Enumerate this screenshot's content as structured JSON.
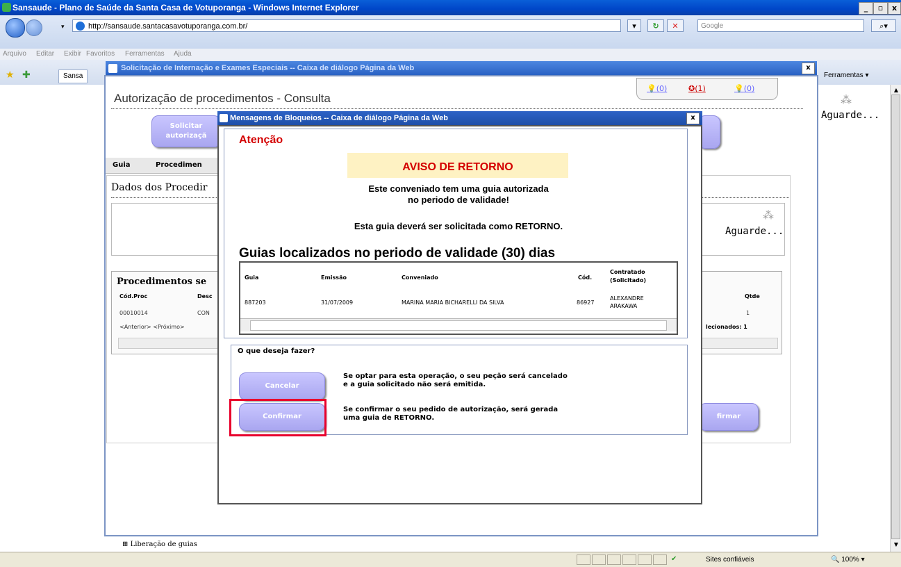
{
  "browser": {
    "title": "Sansaude - Plano de Saúde da Santa Casa de Votuporanga - Windows Internet Explorer",
    "url": "http://sansaude.santacasavotuporanga.com.br/",
    "search_placeholder": "Google",
    "menu": [
      "Arquivo",
      "Editar",
      "Exibir",
      "Favoritos",
      "Ferramentas",
      "Ajuda"
    ],
    "tab_label": "Sansa",
    "tools_label": "Ferramentas",
    "min_label": "_",
    "max_label": "▫",
    "close_label": "x",
    "status_zone": "Sites confiáveis",
    "zoom": "100%"
  },
  "outer_dialog": {
    "title": "Solicitação de Internação e Exames Especiais -- Caixa de diálogo Página da Web",
    "close_label": "x",
    "page_title": "Autorização de procedimentos - Consulta",
    "icon_counts": [
      "(0)",
      "(1)",
      "(0)"
    ],
    "solicitar_label": "Solicitar autorizaçã",
    "tabs": [
      "Guia",
      "Procedimen"
    ],
    "dados_title": "Dados dos Procedir",
    "aguarde_label": "Aguarde...",
    "proc_title": "Procedimentos se",
    "proc_headers": {
      "cod": "Cód.Proc",
      "desc": "Desc",
      "qtde": "Qtde"
    },
    "proc_row": {
      "cod": "00010014",
      "desc": "CON",
      "qtde": "1"
    },
    "paging": "<Anterior> <Próximo>",
    "selecionados": "lecionados: 1",
    "confirmar_bg_label": "firmar",
    "tree_label": "Liberação de guias",
    "aguarde_right": "Aguarde..."
  },
  "inner_dialog": {
    "title": "Mensagens de Bloqueios -- Caixa de diálogo Página da Web",
    "close_label": "x",
    "atencao": "Atenção",
    "aviso": "AVISO DE RETORNO",
    "msg_line1": "Este conveniado tem uma guia autorizada",
    "msg_line2": "no periodo de validade!",
    "msg_line3": "Esta guia deverá ser solicitada como RETORNO.",
    "guias_title": "Guias localizados no periodo de validade (30) dias",
    "table": {
      "headers": [
        "Guia",
        "Emissão",
        "Conveniado",
        "Cód.",
        "Contratado",
        "(Solicitado)"
      ],
      "row": {
        "guia": "887203",
        "emissao": "31/07/2009",
        "conveniado": "MARINA MARIA BICHARELLI DA SILVA",
        "cod": "86927",
        "contratado1": "ALEXANDRE",
        "contratado2": "ARAKAWA"
      }
    },
    "question": "O que deseja fazer?",
    "cancelar_label": "Cancelar",
    "cancelar_msg1": "Se optar para esta operação, o seu peção será cancelado",
    "cancelar_msg2": "e a guia solicitado não será emitida.",
    "confirmar_label": "Confirmar",
    "confirmar_msg1": "Se confirmar o seu pedido de autorização, será gerada",
    "confirmar_msg2": "uma guia de RETORNO."
  },
  "colors": {
    "alert_red": "#d40000",
    "button_lavender": "#b4b1f6",
    "highlight_red": "#e8002c",
    "aviso_bg": "#fef2c3"
  }
}
